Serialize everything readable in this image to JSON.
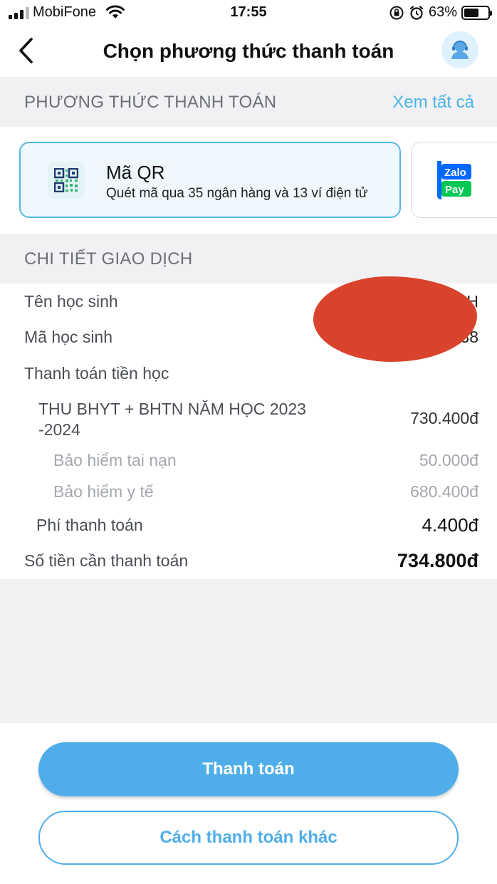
{
  "status_bar": {
    "carrier": "MobiFone",
    "time": "17:55",
    "battery_percent": "63%",
    "battery_level": 0.63
  },
  "header": {
    "title": "Chọn phương thức thanh toán",
    "back_icon": "chevron-left-icon",
    "support_icon": "support-agent-icon"
  },
  "payment_section": {
    "title": "PHƯƠNG THỨC THANH TOÁN",
    "see_all": "Xem tất cả",
    "methods": [
      {
        "name": "Mã QR",
        "description": "Quét mã qua 35 ngân hàng và 13 ví điện tử",
        "icon": "qr-code-icon",
        "selected": true
      },
      {
        "name": "ZaloPay",
        "logo_top": "Zalo",
        "logo_bottom": "Pay",
        "icon": "zalopay-logo",
        "selected": false
      }
    ]
  },
  "details_section": {
    "title": "CHI TIẾT GIAO DỊCH",
    "student_name_label": "Tên học sinh",
    "student_name_value": "NH",
    "student_id_label": "Mã học sinh",
    "student_id_value": "38",
    "tuition_label": "Thanh toán tiền học",
    "fee_item": {
      "label_line1": "THU BHYT + BHTN NĂM HỌC 2023",
      "label_line2": "-2024",
      "value": "730.400đ"
    },
    "sub_items": [
      {
        "label": "Bảo hiểm tai nạn",
        "value": "50.000đ"
      },
      {
        "label": "Bảo hiểm y tế",
        "value": "680.400đ"
      }
    ],
    "payment_fee": {
      "label": "Phí thanh toán",
      "value": "4.400đ"
    },
    "total": {
      "label": "Số tiền cần thanh toán",
      "value": "734.800đ"
    }
  },
  "actions": {
    "pay_label": "Thanh toán",
    "other_label": "Cách thanh toán khác"
  },
  "colors": {
    "accent": "#4faee9",
    "section_bg": "#f1f1f3",
    "redaction": "#d9432b",
    "zalo_blue": "#0068ff",
    "zalo_green": "#00c853"
  }
}
